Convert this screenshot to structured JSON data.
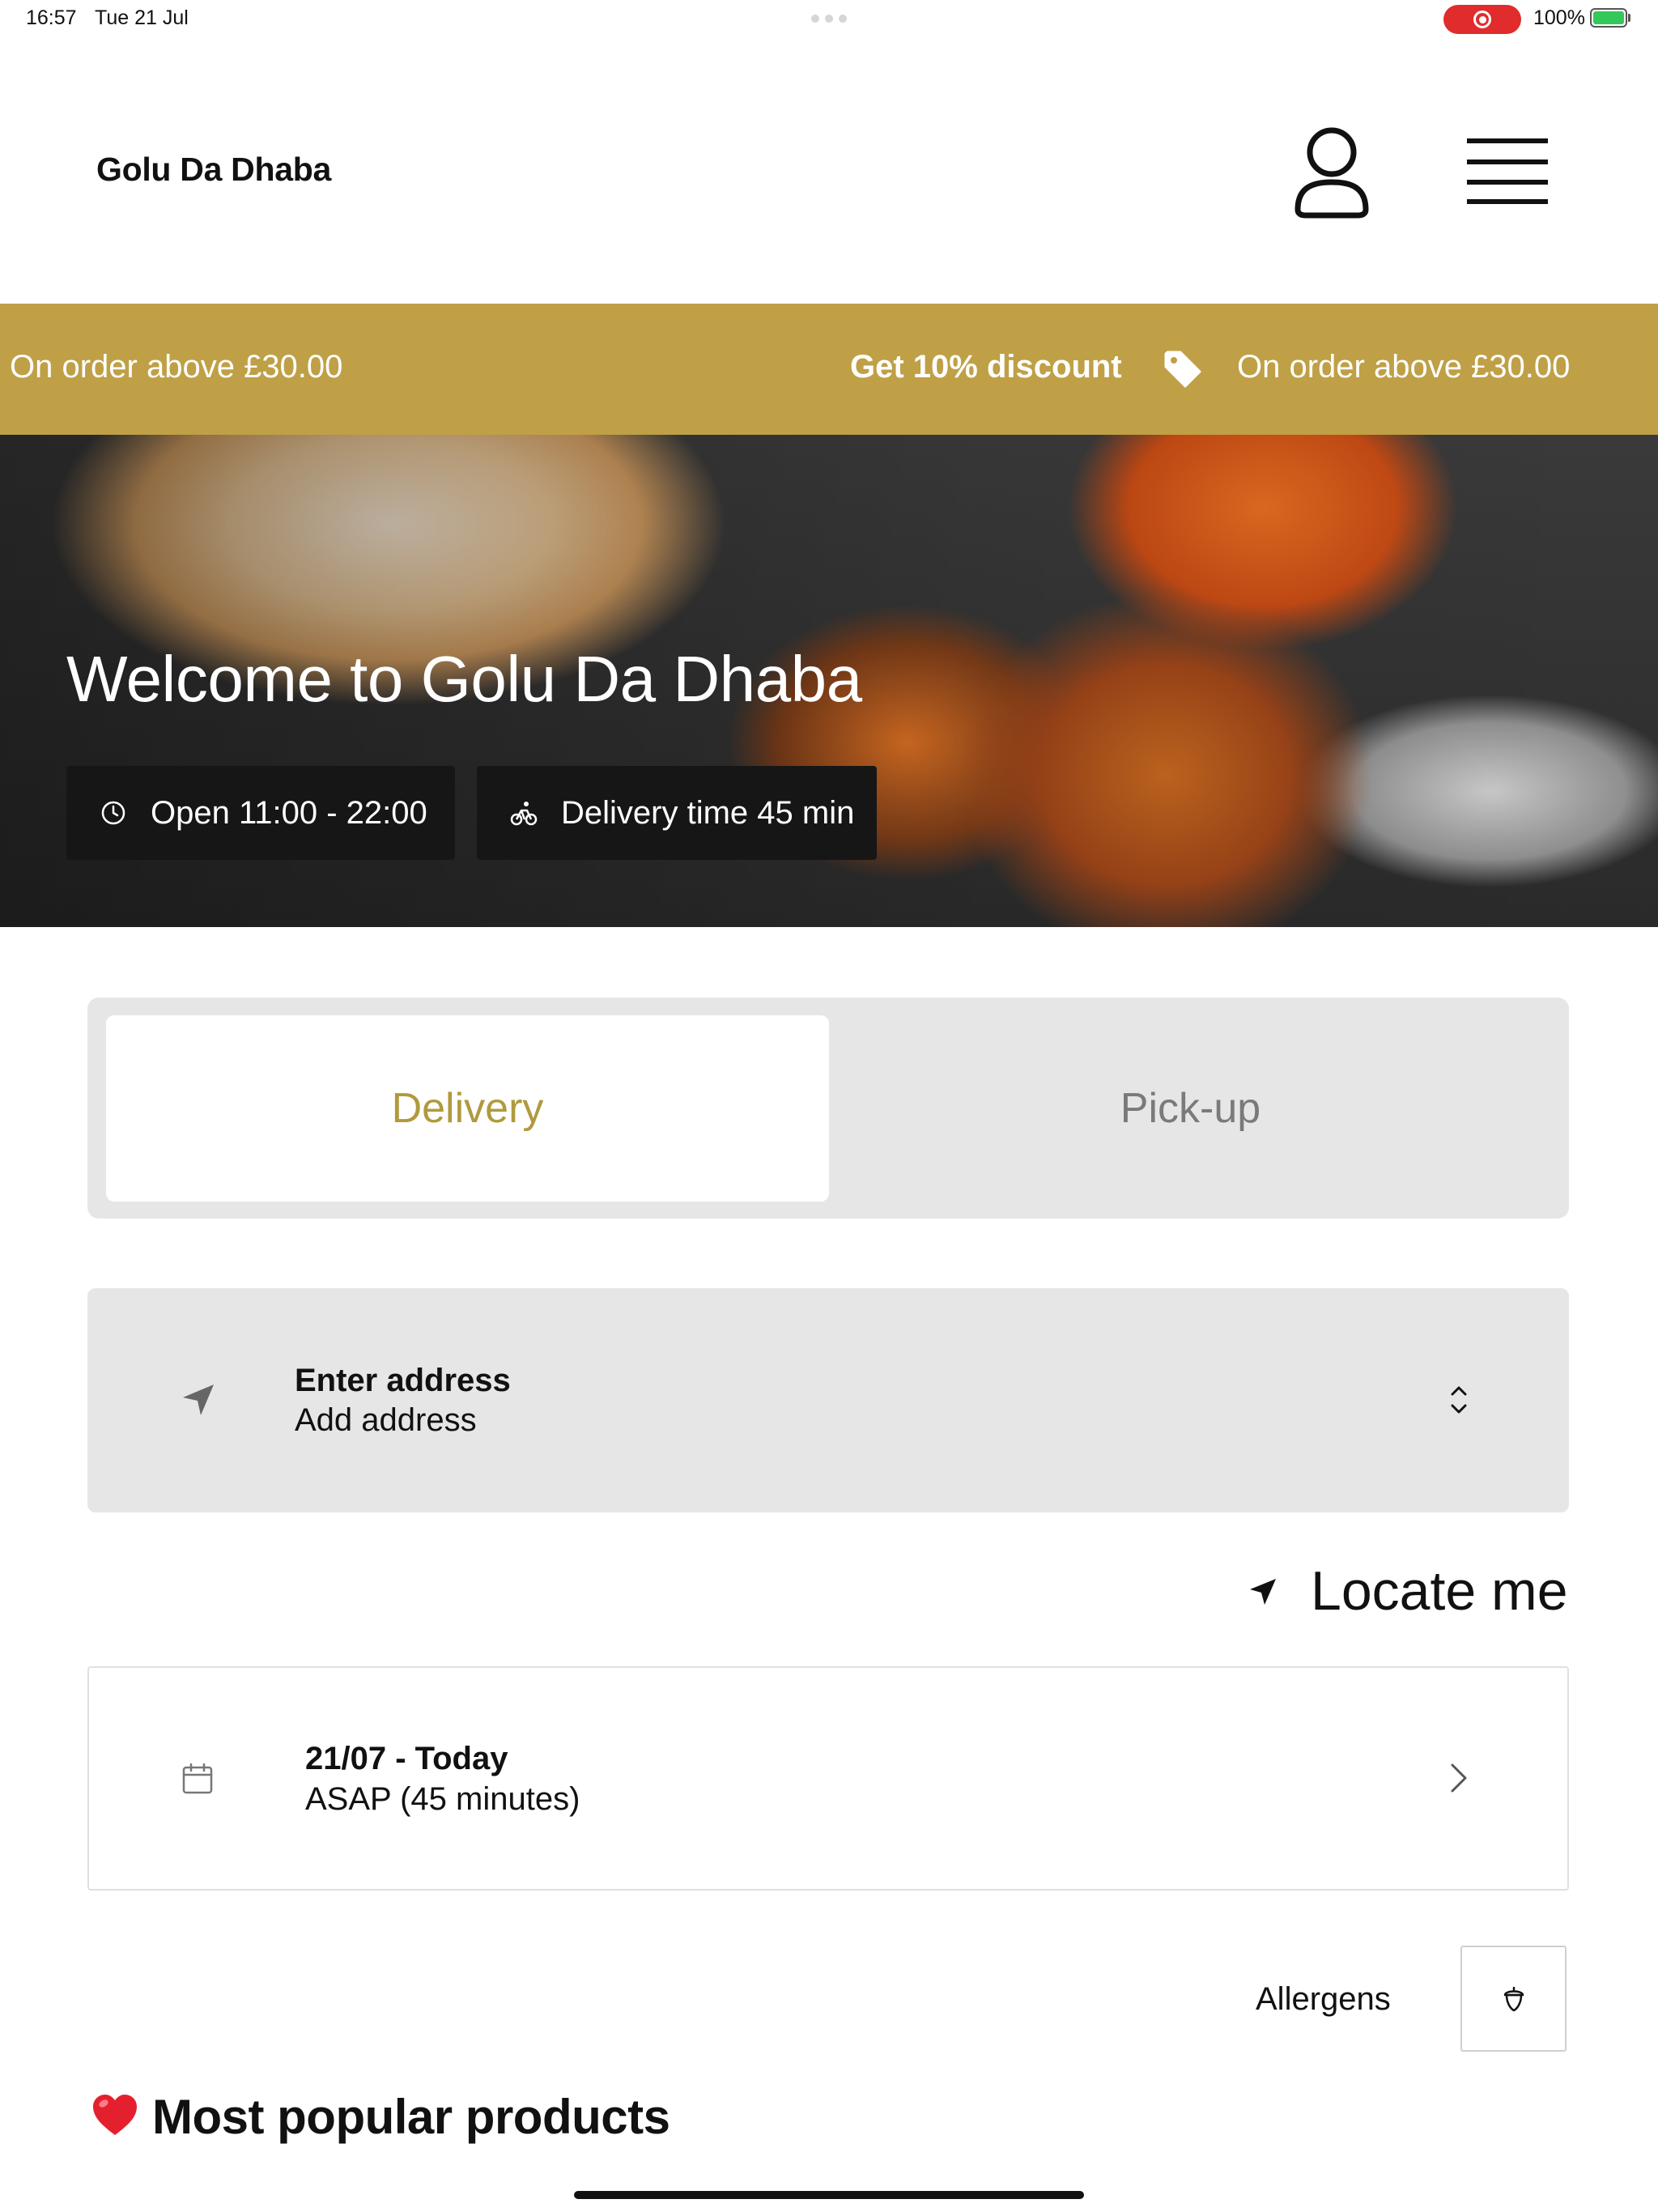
{
  "status_bar": {
    "time": "16:57",
    "date": "Tue 21 Jul",
    "battery": "100%"
  },
  "header": {
    "brand": "Golu Da Dhaba",
    "profile_icon": "profile-icon",
    "menu_icon": "hamburger-menu-icon"
  },
  "promo": {
    "left_text": "On order above £30.00",
    "highlight": "Get 10% discount",
    "right_text": "On order above £30.00",
    "background": "#bfa046"
  },
  "hero": {
    "title": "Welcome to Golu Da Dhaba",
    "open_hours": "Open 11:00 - 22:00",
    "delivery_time": "Delivery time 45 min"
  },
  "order_mode": {
    "delivery": "Delivery",
    "pickup": "Pick-up",
    "selected": "Delivery",
    "accent": "#b09a3d"
  },
  "address": {
    "title": "Enter address",
    "subtitle": "Add address"
  },
  "locate": {
    "label": "Locate me"
  },
  "schedule": {
    "date": "21/07 - Today",
    "time": "ASAP (45 minutes)"
  },
  "allergens": {
    "label": "Allergens"
  },
  "section": {
    "popular_title": "Most popular products"
  }
}
